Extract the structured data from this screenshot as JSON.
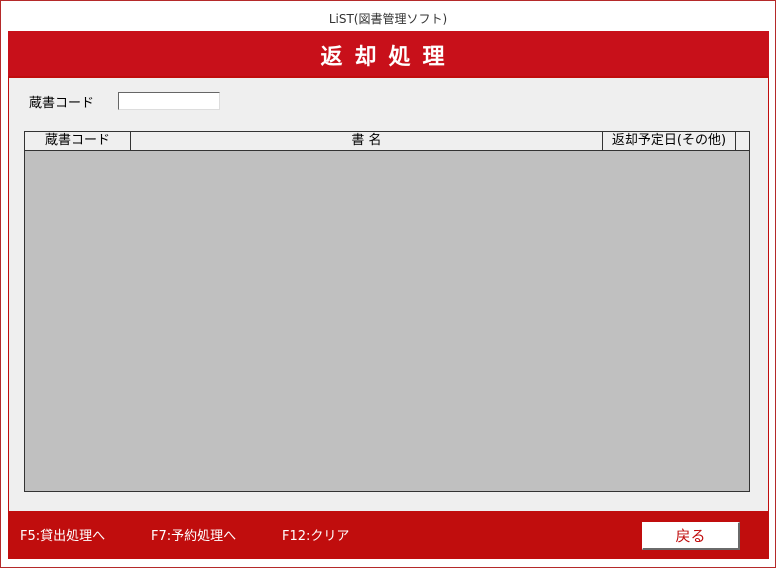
{
  "window": {
    "title": "LiST(図書管理ソフト)"
  },
  "header": {
    "title": "返却処理"
  },
  "form": {
    "code_label": "蔵書コード",
    "code_value": ""
  },
  "table": {
    "columns": [
      "蔵書コード",
      "書 名",
      "返却予定日(その他)"
    ],
    "rows": []
  },
  "footer": {
    "keys": [
      "F5:貸出処理へ",
      "F7:予約処理へ",
      "F12:クリア"
    ],
    "back_label": "戻る"
  },
  "colors": {
    "accent": "#c00d0d",
    "panel": "#efefef",
    "grid": "#c0c0c0"
  }
}
